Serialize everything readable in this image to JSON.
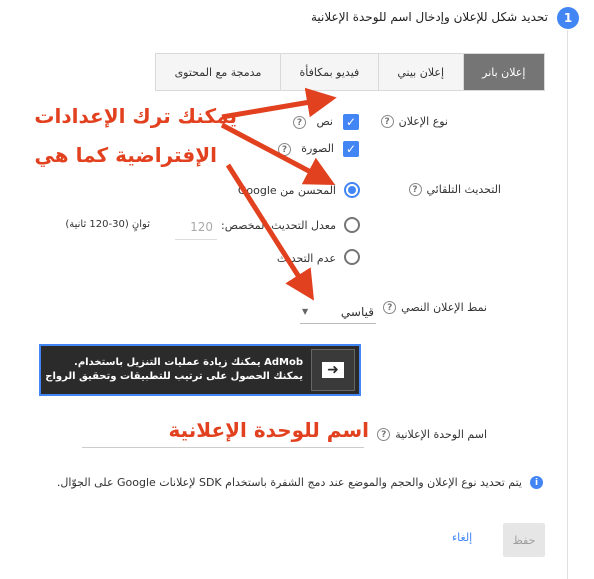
{
  "step": {
    "number": "1",
    "title": "تحديد شكل للإعلان وإدخال اسم للوحدة الإعلانية"
  },
  "tabs": [
    {
      "label": "إعلان بانر",
      "active": true
    },
    {
      "label": "إعلان بيني",
      "active": false
    },
    {
      "label": "فيديو بمكافأة",
      "active": false
    },
    {
      "label": "مدمجة مع المحتوى",
      "active": false
    }
  ],
  "ad_type": {
    "label": "نوع الإعلان",
    "options": [
      {
        "label": "نص",
        "checked": true
      },
      {
        "label": "الصورة",
        "checked": true
      }
    ]
  },
  "refresh": {
    "label": "التحديث التلقائي",
    "options": [
      {
        "label": "المحسن من Google",
        "selected": true
      },
      {
        "label": "معدل التحديث المخصص:",
        "selected": false
      },
      {
        "label": "عدم التحديث",
        "selected": false
      }
    ],
    "custom_value_placeholder": "120",
    "custom_unit": "ثوانٍ (30-120 ثانية)"
  },
  "text_ad_style": {
    "label": "نمط الإعلان النصي",
    "selected": "قياسي"
  },
  "admob_banner": {
    "line1": "AdMob يمكنك زيادة عمليات التنزيل باستخدام.",
    "line2": "يمكنك الحصول على ترتيب للتطبيقات وتحقيق الرواج"
  },
  "ad_unit_name": {
    "label": "اسم الوحدة الإعلانية",
    "value": ""
  },
  "info": {
    "text": "يتم تحديد نوع الإعلان والحجم والموضع عند دمج الشفرة باستخدام SDK لإعلانات Google على الجوّال."
  },
  "actions": {
    "save": "حفظ",
    "cancel": "إلغاء"
  },
  "annotations": {
    "defaults_line1": "يمكنك ترك الإعدادات",
    "defaults_line2": "الإفتراضية كما هي",
    "unit_name": "اسم للوحدة الإعلانية"
  },
  "colors": {
    "accent": "#4285f4",
    "annotation": "#e2411f",
    "active_tab": "#757575",
    "banner_bg": "#2b2b2b"
  }
}
